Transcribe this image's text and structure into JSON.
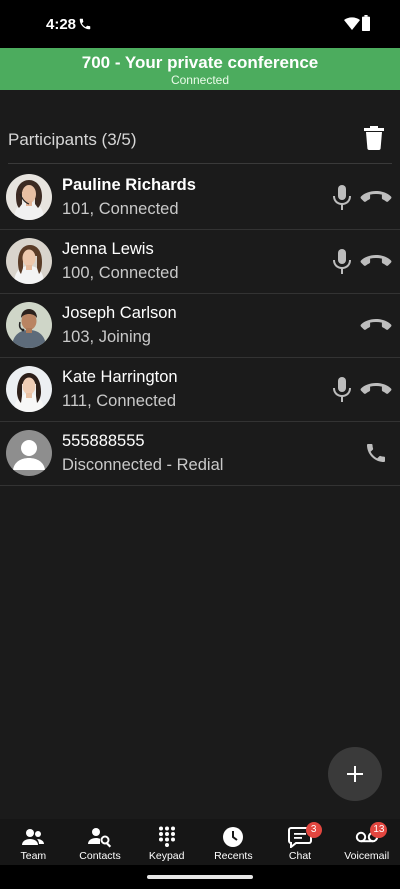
{
  "status_bar": {
    "time": "4:28"
  },
  "conference": {
    "title": "700 - Your private conference",
    "status": "Connected",
    "header_color": "#4cac5e"
  },
  "participants_header": {
    "title": "Participants  (3/5)"
  },
  "participants": [
    {
      "name": "Pauline Richards",
      "status": "101, Connected",
      "avatar": "woman-photo-avatar"
    },
    {
      "name": "Jenna Lewis",
      "status": "100, Connected",
      "avatar": "woman-photo-avatar"
    },
    {
      "name": "Joseph Carlson",
      "status": "103, Joining",
      "avatar": "man-photo-avatar"
    },
    {
      "name": "Kate Harrington",
      "status": "111, Connected",
      "avatar": "woman-photo-avatar"
    },
    {
      "name": "555888555",
      "status": "Disconnected - Redial",
      "avatar": "default-person-avatar"
    }
  ],
  "nav": {
    "items": [
      {
        "label": "Team",
        "icon": "team-icon"
      },
      {
        "label": "Contacts",
        "icon": "contacts-search-icon"
      },
      {
        "label": "Keypad",
        "icon": "keypad-icon"
      },
      {
        "label": "Recents",
        "icon": "clock-icon"
      },
      {
        "label": "Chat",
        "icon": "chat-icon",
        "badge": "3"
      },
      {
        "label": "Voicemail",
        "icon": "voicemail-icon",
        "badge": "13"
      }
    ]
  },
  "colors": {
    "accent_green": "#4cac5e",
    "badge_red": "#e2463f",
    "background": "#1b1b1b"
  }
}
